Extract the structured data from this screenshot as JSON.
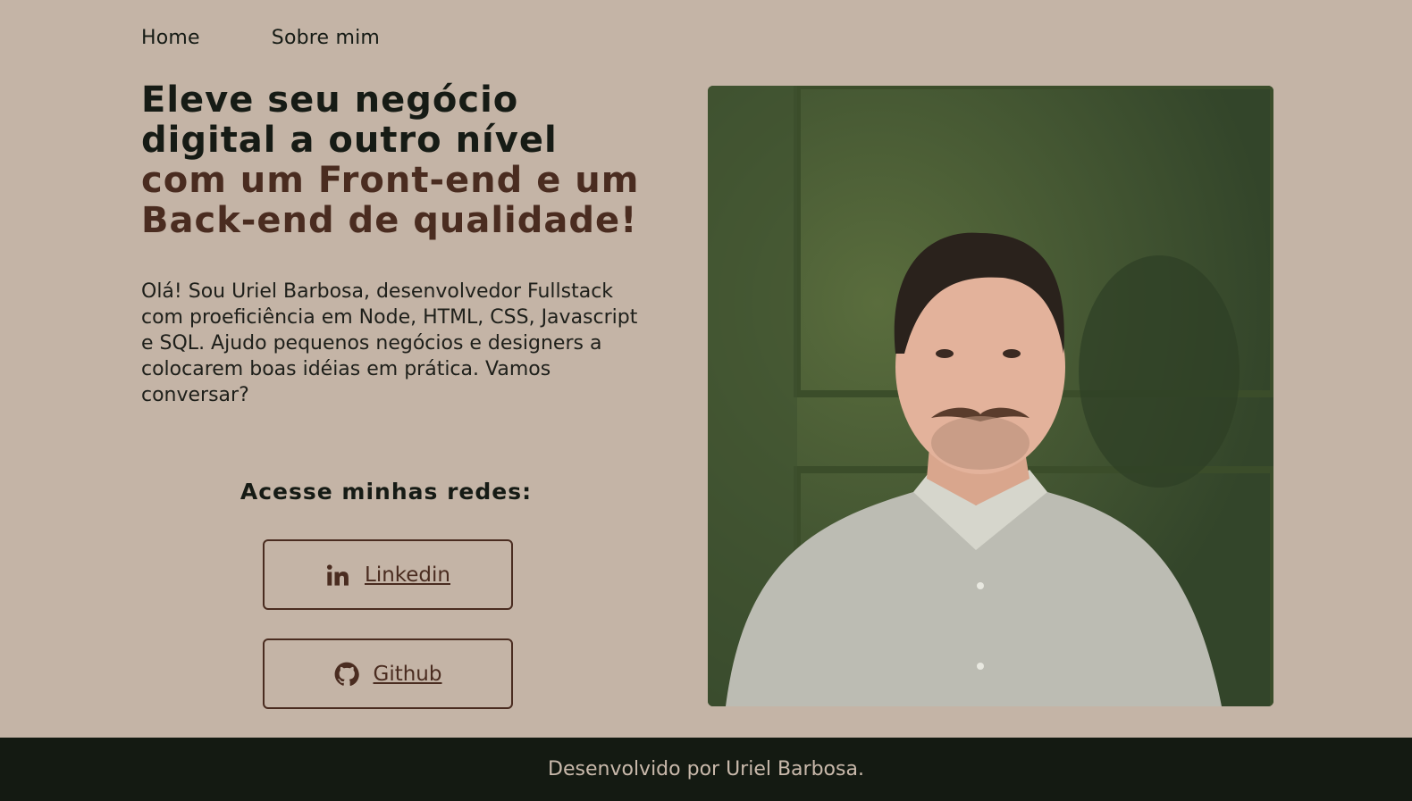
{
  "nav": {
    "home": "Home",
    "about": "Sobre mim"
  },
  "hero": {
    "headline_dark": "Eleve seu negócio digital a outro nível",
    "headline_brown": "com um Front-end e um Back-end de qualidade!",
    "intro": "Olá! Sou Uriel Barbosa, desenvolvedor Fullstack com proeficiência em Node, HTML, CSS, Javascript e SQL. Ajudo pequenos negócios e designers a colocarem boas idéias em prática. Vamos conversar?"
  },
  "social": {
    "title": "Acesse minhas redes:",
    "linkedin": {
      "label": "Linkedin",
      "icon": "linkedin-icon"
    },
    "github": {
      "label": "Github",
      "icon": "github-icon"
    }
  },
  "footer": {
    "text": "Desenvolvido por Uriel Barbosa."
  },
  "colors": {
    "background": "#c4b4a6",
    "dark": "#161b15",
    "brown": "#4a2c20",
    "footer": "#141a12"
  }
}
